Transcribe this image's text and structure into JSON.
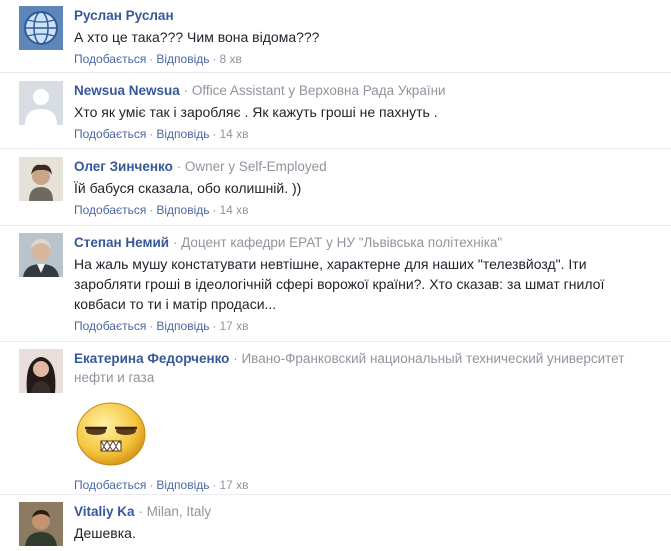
{
  "actions": {
    "like": "Подобається",
    "reply": "Відповідь",
    "dot": "·"
  },
  "comments": [
    {
      "name": "Руслан Руслан",
      "meta": "",
      "text": "А хто це така??? Чим вона відома???",
      "time": "8 хв",
      "avatar_icon": "globe-avatar-icon"
    },
    {
      "name": "Newsua Newsua",
      "meta": "Office Assistant у Верховна Рада України",
      "text": "Хто як уміє так і заробляє . Як кажуть гроші не пахнуть .",
      "time": "14 хв",
      "avatar_icon": "default-profile-avatar-icon"
    },
    {
      "name": "Олег Зинченко",
      "meta": "Owner у Self-Employed",
      "text": "Їй бабуся сказала, обо колишній. ))",
      "time": "14 хв",
      "avatar_icon": "user-photo-avatar-icon"
    },
    {
      "name": "Степан Немий",
      "meta": "Доцент кафедри ЕРАТ у НУ \"Львівська політехніка\"",
      "text": "На жаль мушу констатувати невтішне, характерне для наших \"телезвйозд\". Іти заробляти гроші в ідеологічній сфері ворожої країни?. Хто сказав: за шмат гнилої ковбаси то ти і матір продаси...",
      "time": "17 хв",
      "avatar_icon": "user-photo-avatar-icon"
    },
    {
      "name": "Екатерина Федорченко",
      "meta": "Ивано-Франковский национальный технический университет нефти и газа",
      "text": "",
      "time": "17 хв",
      "avatar_icon": "user-photo-avatar-icon",
      "sticker": "annoyed-face-sticker-icon"
    },
    {
      "name": "Vitaliy Ka",
      "meta": "Milan, Italy",
      "text": "Дешевка.",
      "time": "",
      "avatar_icon": "user-photo-avatar-icon"
    }
  ],
  "colors": {
    "link": "#365899",
    "action": "#4b67a1",
    "meta": "#90949c",
    "text": "#1d2129",
    "divider": "#e9ebee"
  }
}
